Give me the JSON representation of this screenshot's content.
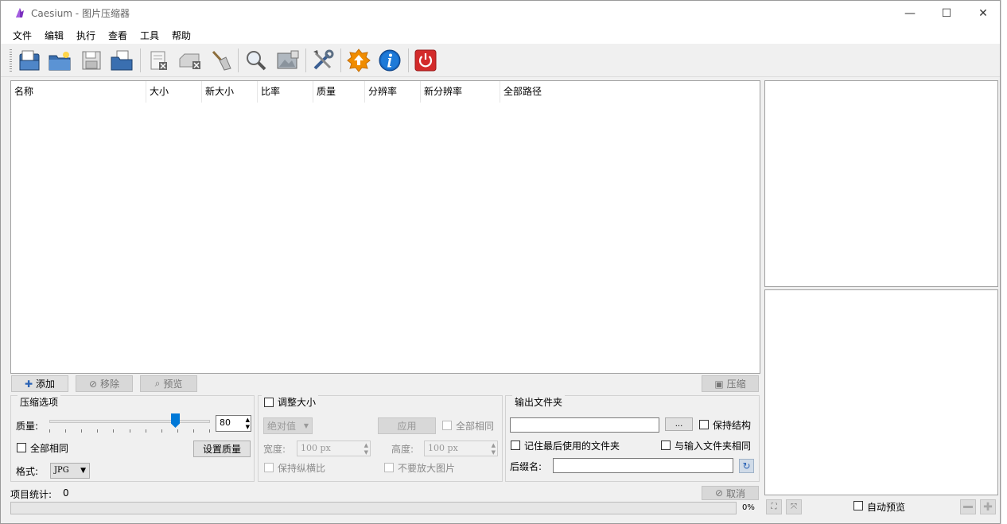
{
  "window": {
    "title": "Caesium - 图片压缩器",
    "minimize": "—",
    "maximize": "☐",
    "close": "✕"
  },
  "menu": [
    "文件",
    "编辑",
    "执行",
    "查看",
    "工具",
    "帮助"
  ],
  "toolbar": {
    "icons": [
      "add-file-icon",
      "add-folder-icon",
      "save-list-icon",
      "open-list-icon",
      "remove-item-icon",
      "clear-list-icon",
      "clean-icon",
      "search-icon",
      "preview-icon",
      "settings-icon",
      "update-icon",
      "info-icon",
      "exit-icon"
    ]
  },
  "file_list": {
    "columns": [
      "名称",
      "大小",
      "新大小",
      "比率",
      "质量",
      "分辨率",
      "新分辨率",
      "全部路径"
    ]
  },
  "buttons": {
    "add": "添加",
    "remove": "移除",
    "preview": "预览",
    "compress": "压缩"
  },
  "compression": {
    "title": "压缩选项",
    "quality_label": "质量:",
    "quality_value": "80",
    "quality_fraction": 0.8,
    "same_all_label": "全部相同",
    "set_quality": "设置质量",
    "format_label": "格式:",
    "format_value": "JPG"
  },
  "resize": {
    "title": "调整大小",
    "mode": "绝对值",
    "apply": "应用",
    "same_all": "全部相同",
    "width_label": "宽度:",
    "width_value": "100 px",
    "height_label": "高度:",
    "height_value": "100 px",
    "keep_ratio": "保持纵横比",
    "no_enlarge": "不要放大图片"
  },
  "output": {
    "title": "输出文件夹",
    "path_value": "",
    "browse": "...",
    "keep_structure": "保持结构",
    "remember_last": "记住最后使用的文件夹",
    "same_as_input": "与输入文件夹相同",
    "suffix_label": "后缀名:",
    "suffix_value": ""
  },
  "status": {
    "items_label": "项目统计:",
    "items_count": "0",
    "cancel": "取消",
    "progress_text": "0%",
    "auto_preview": "自动预览"
  },
  "colors": {
    "accent": "#0078d7",
    "exit_red": "#d32a2a",
    "info_blue": "#1565c0",
    "update_orange": "#f08c00"
  }
}
